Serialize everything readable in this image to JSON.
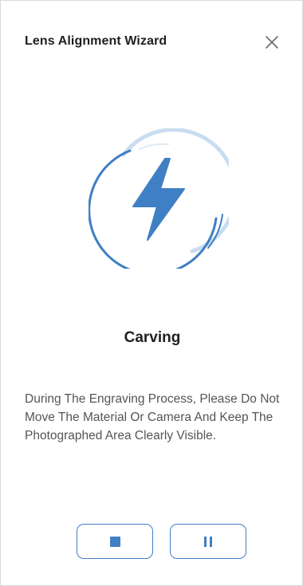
{
  "dialog": {
    "title": "Lens Alignment Wizard",
    "close_icon": "close-icon"
  },
  "progress": {
    "icon": "lightning-bolt-icon",
    "accent_color": "#3f7fc4",
    "light_color": "#c9ddf0"
  },
  "status": {
    "title": "Carving",
    "description": "During The Engraving Process, Please Do Not Move The Material Or Camera And Keep The Photographed Area Clearly Visible."
  },
  "controls": {
    "stop_icon": "stop-icon",
    "pause_icon": "pause-icon"
  }
}
